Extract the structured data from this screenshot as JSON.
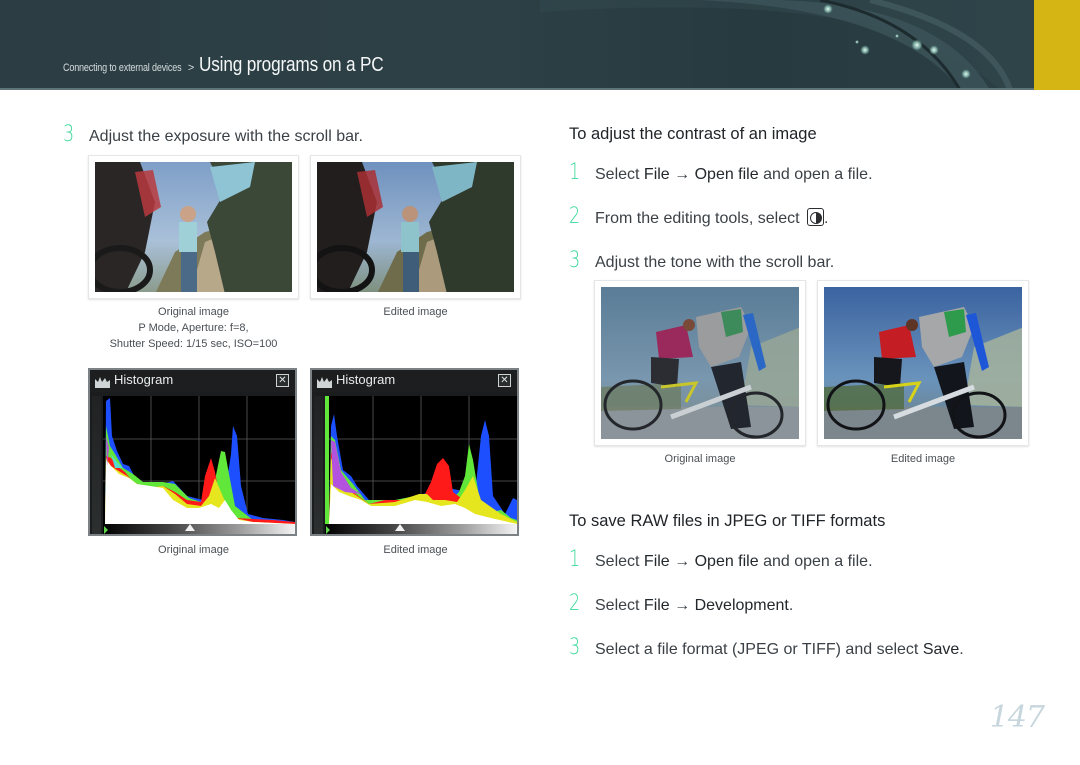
{
  "header": {
    "breadcrumb_parent": "Connecting to external devices",
    "breadcrumb_separator": ">",
    "breadcrumb_current": "Using programs on a PC",
    "accent_color": "#d4b514",
    "banner_color": "#2c3e44"
  },
  "left_column": {
    "step": {
      "number": "3",
      "text": "Adjust the exposure with the scroll bar."
    },
    "photos": [
      {
        "caption": "Original image",
        "details": [
          "P Mode, Aperture: f=8,",
          "Shutter Speed: 1/15 sec, ISO=100"
        ]
      },
      {
        "caption": "Edited image",
        "details": []
      }
    ],
    "histograms": [
      {
        "title": "Histogram",
        "close_label": "✕",
        "caption": "Original image"
      },
      {
        "title": "Histogram",
        "close_label": "✕",
        "caption": "Edited image"
      }
    ]
  },
  "contrast_section": {
    "title": "To adjust the contrast of an image",
    "steps": [
      {
        "number": "1",
        "pre": "Select ",
        "b1": "File",
        "arrow": " → ",
        "b2": "Open file",
        "post": " and open a file."
      },
      {
        "number": "2",
        "pre": "From the editing tools, select ",
        "icon": "contrast-icon",
        "post": "."
      },
      {
        "number": "3",
        "pre": "Adjust the tone with the scroll bar."
      }
    ],
    "photos": [
      {
        "caption": "Original image"
      },
      {
        "caption": "Edited image"
      }
    ]
  },
  "raw_section": {
    "title": "To save RAW files in JPEG or TIFF formats",
    "steps": [
      {
        "number": "1",
        "pre": "Select ",
        "b1": "File",
        "arrow": " → ",
        "b2": "Open file",
        "post": " and open a file."
      },
      {
        "number": "2",
        "pre": "Select ",
        "b1": "File",
        "arrow": " → ",
        "b2": "Development",
        "post": "."
      },
      {
        "number": "3",
        "pre": "Select a file format (JPEG or TIFF) and select ",
        "b1": "Save",
        "post": "."
      }
    ]
  },
  "step_number_color": "#3dd89c",
  "page_number": "147"
}
